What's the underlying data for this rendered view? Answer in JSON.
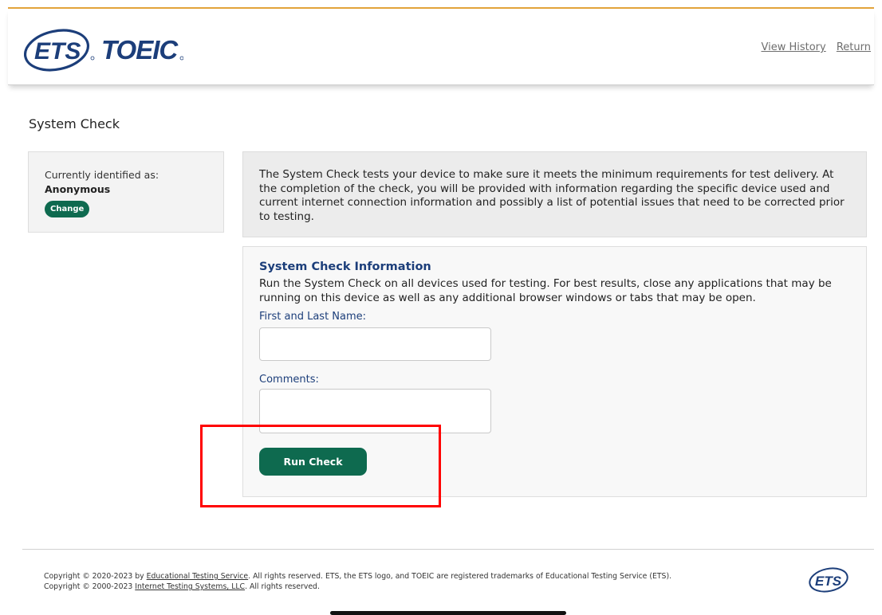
{
  "brand": {
    "logo_main": "ETS",
    "logo_product": "TOEIC",
    "footer_logo": "ETS"
  },
  "colors": {
    "primary_green": "#0e6a4f",
    "heading_blue": "#1c3e7a",
    "accent_orange": "#e2a33a",
    "highlight_red": "#ff0000"
  },
  "header": {
    "links": [
      "View History",
      "Return"
    ]
  },
  "page": {
    "title": "System Check"
  },
  "identity": {
    "caption": "Currently identified as:",
    "name": "Anonymous",
    "change_label": "Change"
  },
  "intro": {
    "text": "The System Check tests your device to make sure it meets the minimum requirements for test delivery. At the completion of the check, you will be provided with information regarding the specific device used and current internet connection information and possibly a list of potential issues that need to be corrected prior to testing."
  },
  "form": {
    "heading": "System Check Information",
    "description": "Run the System Check on all devices used for testing. For best results, close any applications that may be running on this device as well as any additional browser windows or tabs that may be open.",
    "name_label": "First and Last Name:",
    "name_value": "",
    "comments_label": "Comments:",
    "comments_value": "",
    "run_label": "Run Check"
  },
  "footer": {
    "line1_prefix": "Copyright © 2020-2023 by ",
    "line1_link": "Educational Testing Service",
    "line1_suffix": ". All rights reserved. ETS, the ETS logo, and TOEIC are registered trademarks of Educational Testing Service (ETS).",
    "line2_prefix": "Copyright © 2000-2023 ",
    "line2_link": "Internet Testing Systems, LLC",
    "line2_suffix": ". All rights reserved."
  }
}
